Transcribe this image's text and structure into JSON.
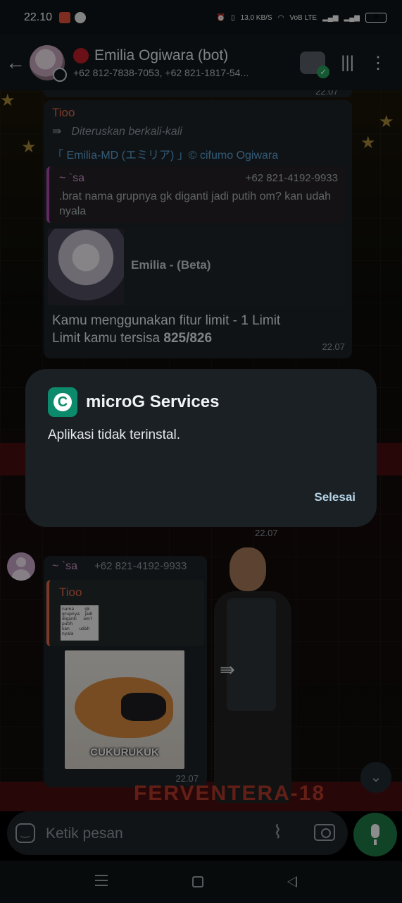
{
  "status_bar": {
    "time": "22.10",
    "net_speed": "13,0 KB/S",
    "volte": "VoB LTE",
    "battery": "9"
  },
  "header": {
    "title": "Emilia Ogiwara (bot)",
    "subtitle": "+62 812-7838-7053, +62 821-1817-54..."
  },
  "messages": {
    "top_time": "22.07",
    "m1": {
      "sender": "Tioo",
      "forwarded": "Diteruskan berkali-kali",
      "link": "「 Emilia-MD (エミリア) 」© cifumo Ogiwara",
      "quote_name": "~ `sa",
      "quote_phone": "+62 821-4192-9933",
      "quote_text": ".brat nama grupnya gk diganti jadi putih om? kan udah nyala",
      "preview_title": "Emilia - (Beta)",
      "body_line1": "Kamu menggunakan fitur limit - 1 Limit",
      "body_line2_prefix": "Limit kamu tersisa ",
      "body_line2_bold": "825/826",
      "time": "22.07"
    },
    "mid_time": "22.07",
    "m2": {
      "sender": "~ `sa",
      "phone": "+62 821-4192-9933",
      "quote_name": "Tioo",
      "thumb_text": "nama        gk\ngrupnya    jadi\ndiganti     om?\nputih\nkan       udah\nnyala",
      "sticker_text": "CUKURUKUK",
      "time": "22.07"
    },
    "event_text": "FERVENTERA-18"
  },
  "dialog": {
    "app_name": "microG Services",
    "message": "Aplikasi tidak terinstal.",
    "button": "Selesai"
  },
  "input": {
    "placeholder": "Ketik pesan"
  },
  "colors": {
    "accent_green": "#1f7a46",
    "link_blue": "#5ba4d6",
    "sender_orange": "#e06a4a",
    "quote_purple": "#b34bb0"
  }
}
